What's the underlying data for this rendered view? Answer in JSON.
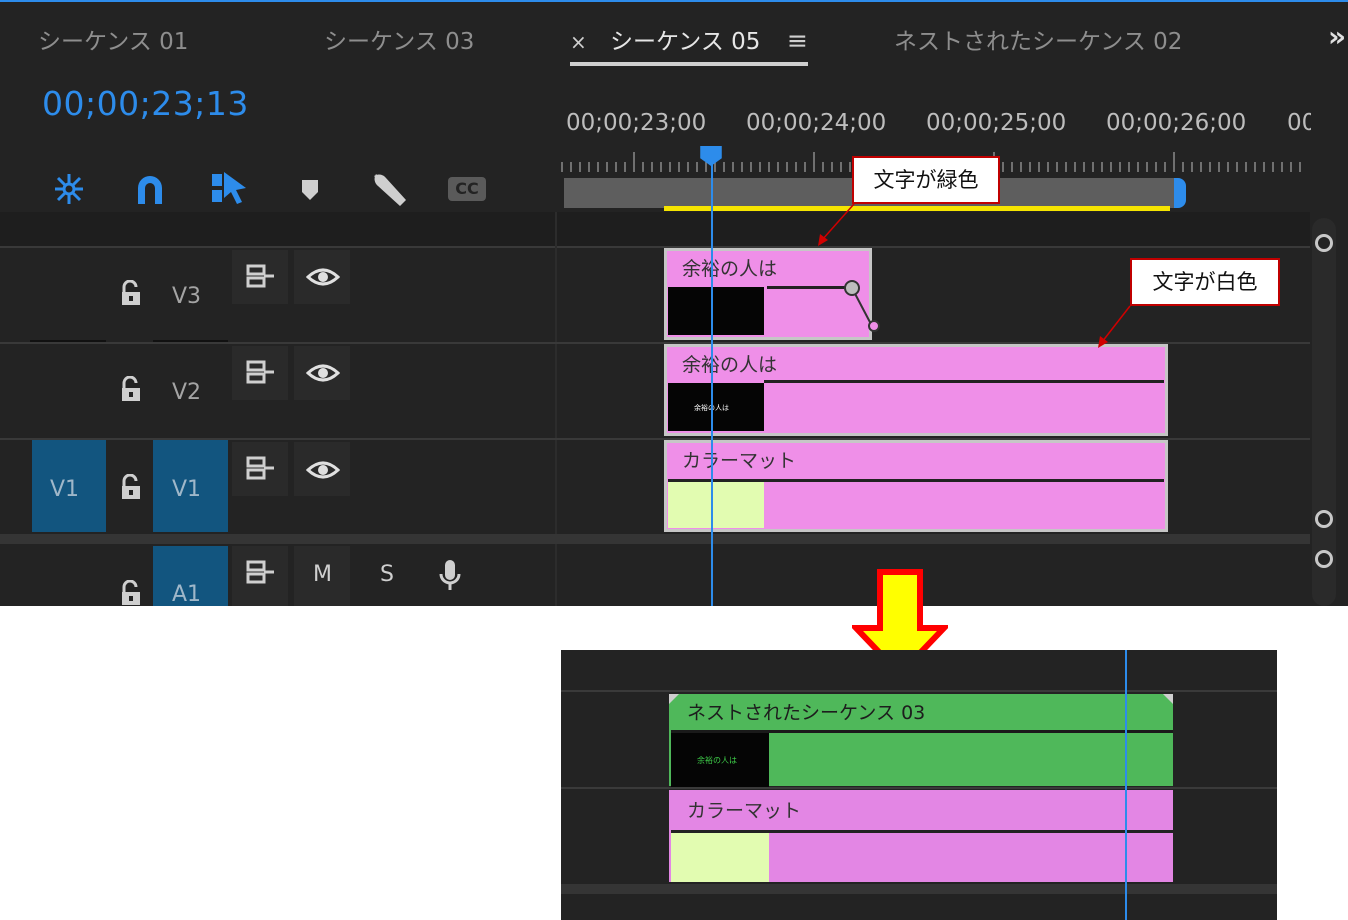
{
  "tabs": [
    {
      "label": "シーケンス 01",
      "active": false
    },
    {
      "label": "シーケンス 03",
      "active": false
    },
    {
      "label": "シーケンス 05",
      "active": true
    },
    {
      "label": "ネストされたシーケンス 02",
      "active": false
    }
  ],
  "tab_close_glyph": "×",
  "tab_menu_glyph": "≡",
  "overflow_glyph": "»",
  "timecode": "00;00;23;13",
  "ruler": [
    "00;00;23;00",
    "00;00;24;00",
    "00;00;25;00",
    "00;00;26;00",
    "00"
  ],
  "toolbar": {
    "icons": [
      "snap-sequence-icon",
      "magnet-icon",
      "linked-selection-icon",
      "marker-icon",
      "wrench-icon",
      "captions-icon"
    ],
    "captions_label": "CC"
  },
  "tracks": {
    "v3": {
      "label": "V3"
    },
    "v2": {
      "label": "V2"
    },
    "v1": {
      "label": "V1",
      "source_label": "V1"
    },
    "a1": {
      "label": "A1",
      "m_label": "M",
      "s_label": "S"
    }
  },
  "clips": {
    "v3": {
      "title": "余裕の人は",
      "thumb_text": ""
    },
    "v2": {
      "title": "余裕の人は",
      "thumb_text": "余裕の人は"
    },
    "v1": {
      "title": "カラーマット"
    }
  },
  "callouts": {
    "green": "文字が緑色",
    "white": "文字が白色"
  },
  "bottom": {
    "nested_clip_title": "ネストされたシーケンス 03",
    "nested_thumb_text": "余裕の人は",
    "matte_clip_title": "カラーマット"
  },
  "colors": {
    "accent": "#2d8ceb",
    "clip_pink": "#ef8fe8",
    "clip_green": "#4fb85a",
    "matte_swatch": "#e2fcb1",
    "yellow_bar": "#f5e400",
    "callout_border": "#c00000",
    "arrow_fill": "#ffff00",
    "arrow_stroke": "#ff0000"
  }
}
